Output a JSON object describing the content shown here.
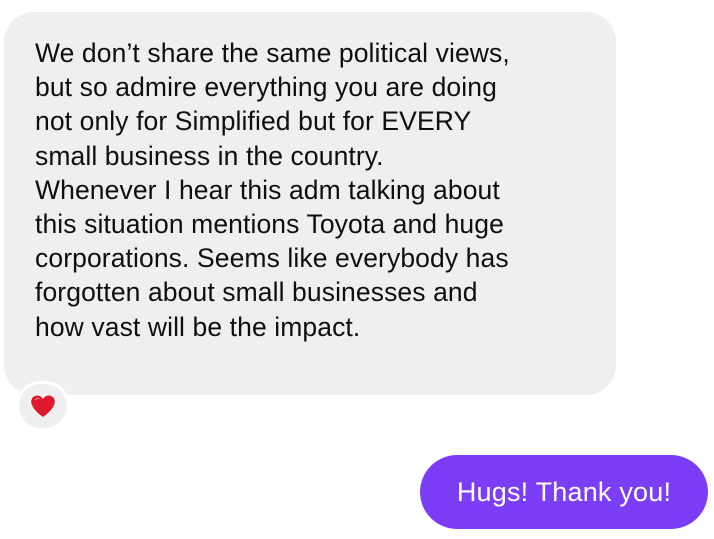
{
  "conversation": {
    "incoming_message": {
      "lines": [
        "We don’t share the same political views,",
        "but so admire everything you are doing",
        "not only for Simplified but for EVERY",
        "small business in the country.",
        "Whenever I hear this adm talking about",
        "this situation mentions Toyota and huge",
        "corporations. Seems like everybody has",
        "forgotten about small businesses and",
        "how vast will be the impact."
      ],
      "reaction_icon": "red-heart-icon"
    },
    "outgoing_message": {
      "text": "Hugs! Thank you!"
    }
  },
  "colors": {
    "incoming_bubble": "#efeff1",
    "incoming_text": "#0f0f0f",
    "outgoing_bubble": "#7b3df6",
    "outgoing_text": "#ffffff",
    "heart": "#e0182d"
  }
}
